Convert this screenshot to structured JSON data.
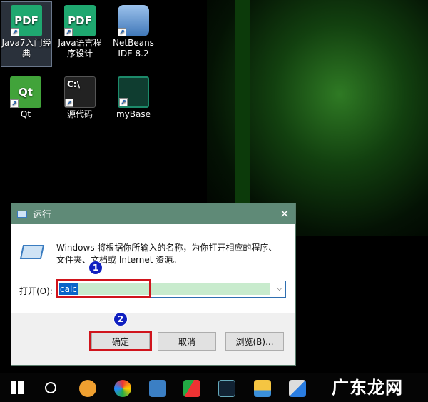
{
  "desktop": {
    "icons": [
      {
        "label": "Java7入门经典",
        "glyph": "PDF",
        "color": "#1fa870"
      },
      {
        "label": "Java语言程序设计",
        "glyph": "PDF",
        "color": "#1fa870"
      },
      {
        "label": "NetBeans IDE 8.2",
        "glyph": "cube-icon",
        "color": "#5a8fc8"
      },
      {
        "label": "Qt",
        "glyph": "Qt",
        "color": "#41a33a"
      },
      {
        "label": "源代码",
        "glyph": "C:\\",
        "color": "#222"
      },
      {
        "label": "myBase",
        "glyph": "note-icon",
        "color": "#1c8a6a"
      }
    ]
  },
  "dialog": {
    "title": "运行",
    "message": "Windows 将根据你所输入的名称，为你打开相应的程序、文件夹、文档或 Internet 资源。",
    "open_label": "打开(O):",
    "input_value": "calc",
    "ok": "确定",
    "cancel": "取消",
    "browse": "浏览(B)..."
  },
  "annotations": {
    "step1": "1",
    "step2": "2"
  },
  "watermark": "广东龙网"
}
